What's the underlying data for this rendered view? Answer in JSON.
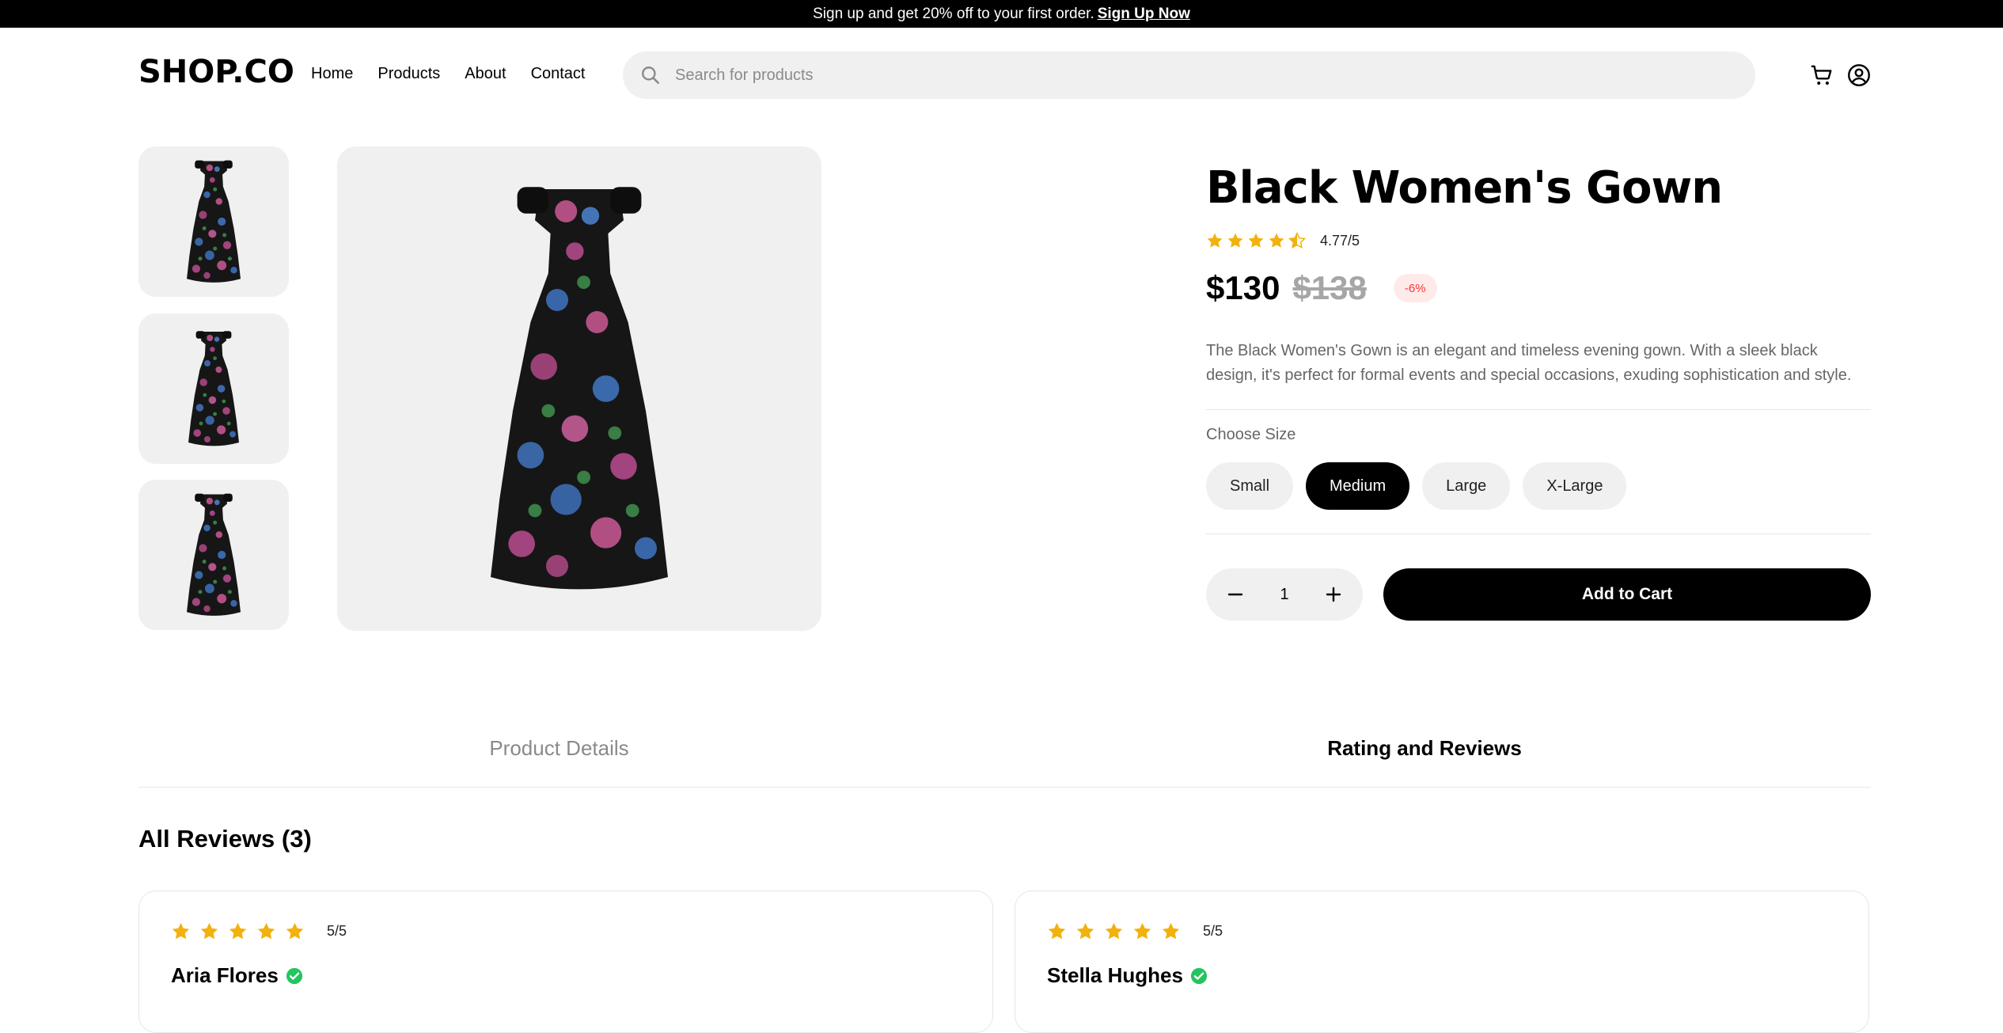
{
  "announcement": {
    "text": "Sign up and get 20% off to your first order.",
    "link": "Sign Up Now"
  },
  "header": {
    "logo": "SHOP.CO",
    "nav": [
      "Home",
      "Products",
      "About",
      "Contact"
    ],
    "search_placeholder": "Search for products",
    "icons": [
      "cart-icon",
      "user-icon"
    ]
  },
  "gallery": {
    "thumbnails": [
      "dress-front",
      "dress-side",
      "dress-back"
    ],
    "main_image": "dress-front"
  },
  "product": {
    "title": "Black Women's Gown",
    "rating_text": "4.77/5",
    "rating": 4.77,
    "price": "$130",
    "old_price": "$138",
    "discount": "-6%",
    "description": "The Black Women's Gown is an elegant and timeless evening gown. With a sleek black design, it's perfect for formal events and special occasions, exuding sophistication and style.",
    "size_label": "Choose Size",
    "sizes": [
      "Small",
      "Medium",
      "Large",
      "X-Large"
    ],
    "selected_size": "Medium",
    "quantity": "1",
    "add_to_cart": "Add to Cart"
  },
  "tabs": {
    "details": "Product Details",
    "reviews": "Rating and Reviews",
    "active": "Rating and Reviews"
  },
  "reviews": {
    "heading": "All Reviews (3)",
    "items": [
      {
        "name": "Aria Flores",
        "rating_text": "5/5",
        "rating": 5
      },
      {
        "name": "Stella Hughes",
        "rating_text": "5/5",
        "rating": 5
      }
    ]
  },
  "colors": {
    "star": "#f2b10c",
    "verified": "#22c55e",
    "discount_bg": "#ffeaea",
    "discount_text": "#ff3333",
    "surface": "#f0f0f0"
  }
}
